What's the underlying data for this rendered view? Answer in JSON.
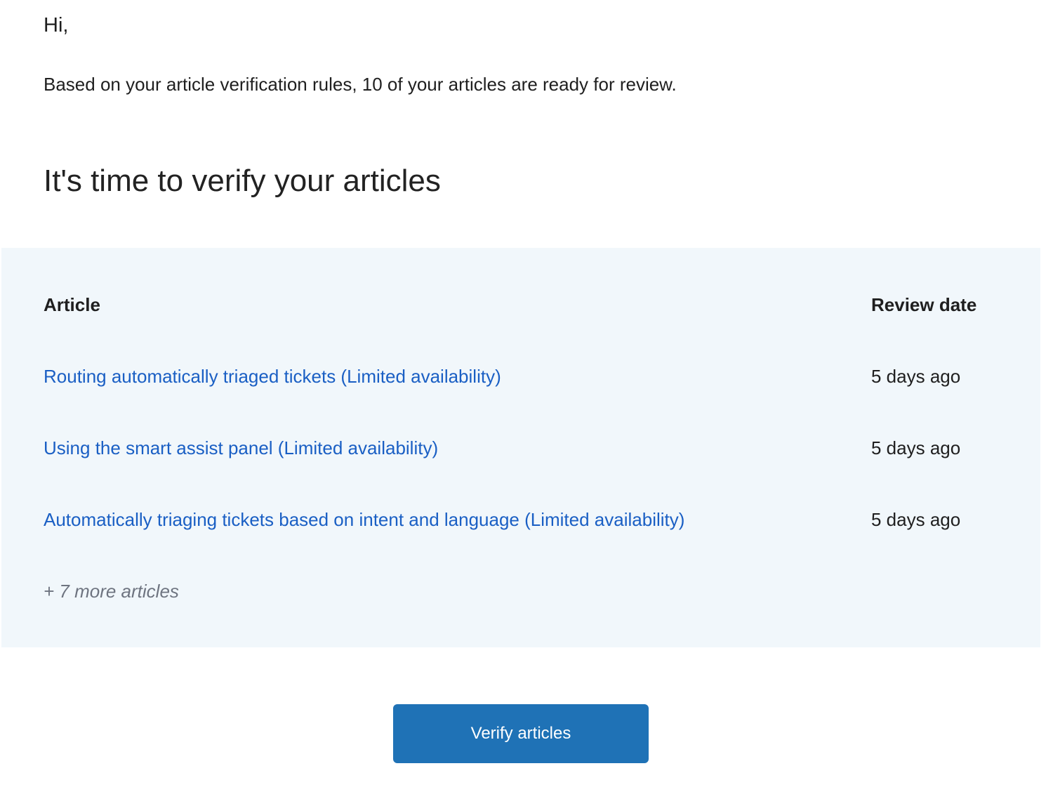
{
  "email": {
    "greeting": "Hi,",
    "intro": "Based on your article verification rules, 10 of your articles are ready for review.",
    "heading": "It's time to verify your articles"
  },
  "table": {
    "columns": {
      "article": "Article",
      "review_date": "Review date"
    },
    "rows": [
      {
        "title": "Routing automatically triaged tickets (Limited availability)",
        "review_date": "5 days ago"
      },
      {
        "title": "Using the smart assist panel (Limited availability)",
        "review_date": "5 days ago"
      },
      {
        "title": "Automatically triaging tickets based on intent and language (Limited availability)",
        "review_date": "5 days ago"
      }
    ],
    "more": "+ 7 more articles"
  },
  "cta": {
    "label": "Verify articles"
  },
  "colors": {
    "link": "#1a5fc4",
    "panel_background": "#f1f7fb",
    "button_background": "#1f72b6",
    "muted_text": "#6e7480"
  }
}
